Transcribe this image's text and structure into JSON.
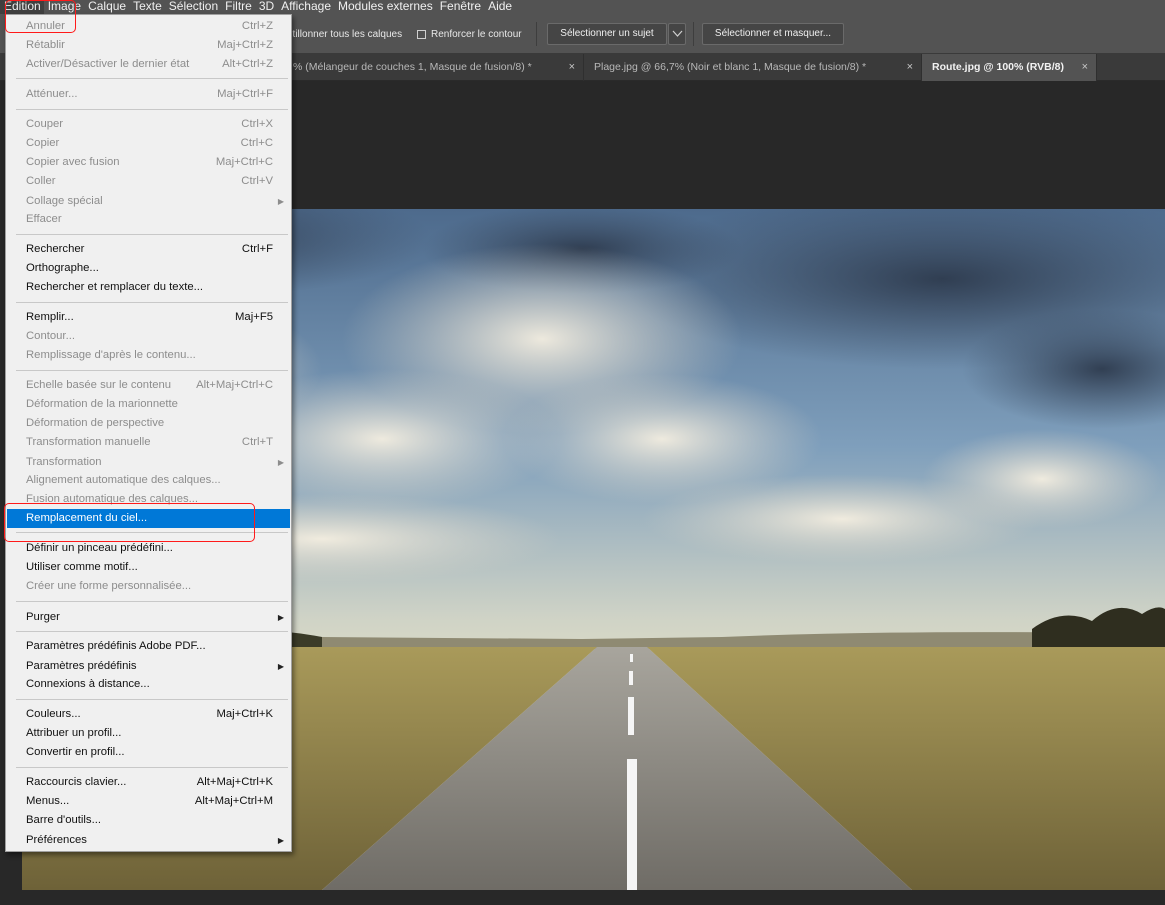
{
  "menubar": {
    "items": [
      "Edition",
      "Image",
      "Calque",
      "Texte",
      "Sélection",
      "Filtre",
      "3D",
      "Affichage",
      "Modules externes",
      "Fenêtre",
      "Aide"
    ]
  },
  "options": {
    "sample_all_layers": "ntillonner tous les calques",
    "enhance_edge": "Renforcer le contour",
    "select_subject": "Sélectionner un sujet",
    "select_and_mask": "Sélectionner et masquer..."
  },
  "tabs": [
    {
      "label": "% (Mélangeur de couches 1, Masque de fusion/8) *",
      "close": "×"
    },
    {
      "label": "Plage.jpg @ 66,7% (Noir et blanc 1, Masque de fusion/8) *",
      "close": "×"
    },
    {
      "label": "Route.jpg @ 100% (RVB/8)",
      "close": "×"
    }
  ],
  "edit_menu": {
    "items": [
      {
        "label": "Annuler",
        "shortcut": "Ctrl+Z",
        "disabled": true
      },
      {
        "label": "Rétablir",
        "shortcut": "Maj+Ctrl+Z",
        "disabled": true
      },
      {
        "label": "Activer/Désactiver le dernier état",
        "shortcut": "Alt+Ctrl+Z",
        "disabled": true
      },
      {
        "label": "Atténuer...",
        "shortcut": "Maj+Ctrl+F",
        "disabled": true
      },
      {
        "label": "Couper",
        "shortcut": "Ctrl+X",
        "disabled": true
      },
      {
        "label": "Copier",
        "shortcut": "Ctrl+C",
        "disabled": true
      },
      {
        "label": "Copier avec fusion",
        "shortcut": "Maj+Ctrl+C",
        "disabled": true
      },
      {
        "label": "Coller",
        "shortcut": "Ctrl+V",
        "disabled": true
      },
      {
        "label": "Collage spécial",
        "shortcut": "",
        "disabled": true,
        "submenu": true
      },
      {
        "label": "Effacer",
        "shortcut": "",
        "disabled": true
      },
      {
        "label": "Rechercher",
        "shortcut": "Ctrl+F",
        "disabled": false
      },
      {
        "label": "Orthographe...",
        "shortcut": "",
        "disabled": false
      },
      {
        "label": "Rechercher et remplacer du texte...",
        "shortcut": "",
        "disabled": false
      },
      {
        "label": "Remplir...",
        "shortcut": "Maj+F5",
        "disabled": false
      },
      {
        "label": "Contour...",
        "shortcut": "",
        "disabled": true
      },
      {
        "label": "Remplissage d'après le contenu...",
        "shortcut": "",
        "disabled": true
      },
      {
        "label": "Echelle basée sur le contenu",
        "shortcut": "Alt+Maj+Ctrl+C",
        "disabled": true
      },
      {
        "label": "Déformation de la marionnette",
        "shortcut": "",
        "disabled": true
      },
      {
        "label": "Déformation de perspective",
        "shortcut": "",
        "disabled": true
      },
      {
        "label": "Transformation manuelle",
        "shortcut": "Ctrl+T",
        "disabled": true
      },
      {
        "label": "Transformation",
        "shortcut": "",
        "disabled": true,
        "submenu": true
      },
      {
        "label": "Alignement automatique des calques...",
        "shortcut": "",
        "disabled": true
      },
      {
        "label": "Fusion automatique des calques...",
        "shortcut": "",
        "disabled": true
      },
      {
        "label": "Remplacement du ciel...",
        "shortcut": "",
        "disabled": false,
        "highlighted": true
      },
      {
        "label": "Définir un pinceau prédéfini...",
        "shortcut": "",
        "disabled": false
      },
      {
        "label": "Utiliser comme motif...",
        "shortcut": "",
        "disabled": false
      },
      {
        "label": "Créer une forme personnalisée...",
        "shortcut": "",
        "disabled": true
      },
      {
        "label": "Purger",
        "shortcut": "",
        "disabled": false,
        "submenu": true
      },
      {
        "label": "Paramètres prédéfinis Adobe PDF...",
        "shortcut": "",
        "disabled": false
      },
      {
        "label": "Paramètres prédéfinis",
        "shortcut": "",
        "disabled": false,
        "submenu": true
      },
      {
        "label": "Connexions à distance...",
        "shortcut": "",
        "disabled": false
      },
      {
        "label": "Couleurs...",
        "shortcut": "Maj+Ctrl+K",
        "disabled": false
      },
      {
        "label": "Attribuer un profil...",
        "shortcut": "",
        "disabled": false
      },
      {
        "label": "Convertir en profil...",
        "shortcut": "",
        "disabled": false
      },
      {
        "label": "Raccourcis clavier...",
        "shortcut": "Alt+Maj+Ctrl+K",
        "disabled": false
      },
      {
        "label": "Menus...",
        "shortcut": "Alt+Maj+Ctrl+M",
        "disabled": false
      },
      {
        "label": "Barre d'outils...",
        "shortcut": "",
        "disabled": false
      },
      {
        "label": "Préférences",
        "shortcut": "",
        "disabled": false,
        "submenu": true
      }
    ]
  },
  "icons": {
    "submenu_arrow": "triangle-right-icon",
    "dropdown_toggle": "chevron-down-icon",
    "tab_close": "close-icon"
  },
  "colors": {
    "highlight": "#0078d7",
    "annotation": "#ff1a1a",
    "menubar": "#535353",
    "workspace": "#282828"
  }
}
